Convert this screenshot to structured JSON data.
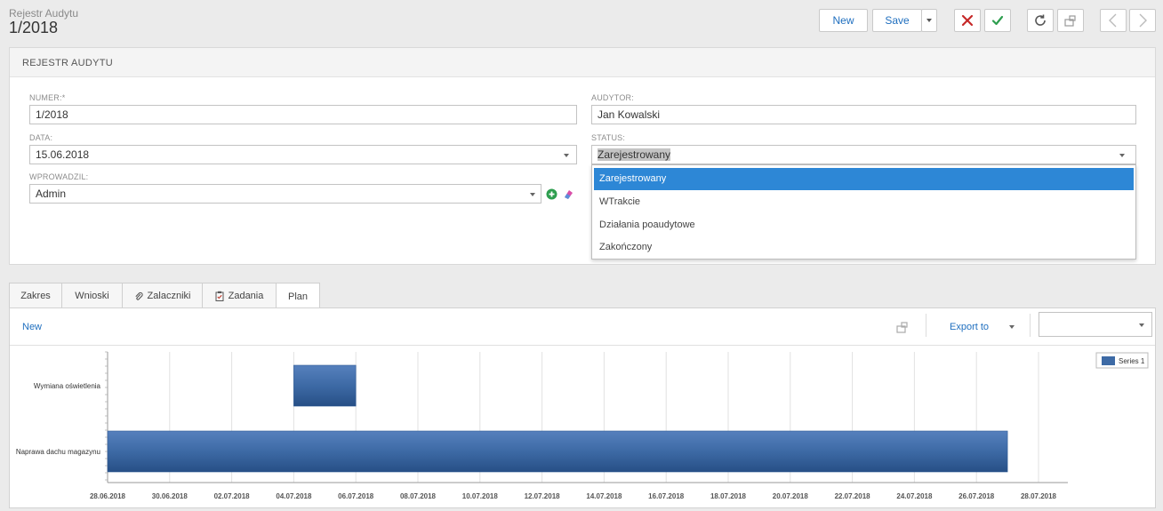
{
  "header": {
    "breadcrumb": "Rejestr Audytu",
    "title": "1/2018"
  },
  "toolbar": {
    "new_label": "New",
    "save_label": "Save"
  },
  "panel": {
    "title": "REJESTR AUDYTU"
  },
  "form": {
    "numer": {
      "label": "NUMER:*",
      "value": "1/2018"
    },
    "data": {
      "label": "DATA:",
      "value": "15.06.2018"
    },
    "wprowadzil": {
      "label": "WPROWADZIL:",
      "value": "Admin"
    },
    "audytor": {
      "label": "AUDYTOR:",
      "value": "Jan Kowalski"
    },
    "status": {
      "label": "STATUS:",
      "value": "Zarejestrowany",
      "options": [
        "Zarejestrowany",
        "WTrakcie",
        "Działania poaudytowe",
        "Zakończony"
      ],
      "selected_index": 0
    }
  },
  "tabs": [
    {
      "label": "Zakres",
      "icon": ""
    },
    {
      "label": "Wnioski",
      "icon": ""
    },
    {
      "label": "Zalaczniki",
      "icon": "paperclip-icon"
    },
    {
      "label": "Zadania",
      "icon": "clipboard-icon"
    },
    {
      "label": "Plan",
      "icon": "",
      "active": true
    }
  ],
  "plan_toolbar": {
    "new_label": "New",
    "export_label": "Export to"
  },
  "colors": {
    "accent": "#2d87d6",
    "bar": "#3d6aa5",
    "cancel": "#c0392b",
    "confirm": "#2e9e4f"
  },
  "chart_data": {
    "type": "bar",
    "orientation": "horizontal-range",
    "categories": [
      "Wymiana oświetlenia",
      "Naprawa dachu magazynu"
    ],
    "series": [
      {
        "name": "Series 1",
        "ranges": [
          {
            "category": "Wymiana oświetlenia",
            "start": "2018-07-04",
            "end": "2018-07-06"
          },
          {
            "category": "Naprawa dachu magazynu",
            "start": "2018-06-28",
            "end": "2018-07-27"
          }
        ]
      }
    ],
    "x_ticks": [
      "28.06.2018",
      "30.06.2018",
      "02.07.2018",
      "04.07.2018",
      "06.07.2018",
      "08.07.2018",
      "10.07.2018",
      "12.07.2018",
      "14.07.2018",
      "16.07.2018",
      "18.07.2018",
      "20.07.2018",
      "22.07.2018",
      "24.07.2018",
      "26.07.2018",
      "28.07.2018"
    ],
    "xlim": [
      "2018-06-28",
      "2018-07-30"
    ],
    "grid": true,
    "legend": "top-right"
  }
}
